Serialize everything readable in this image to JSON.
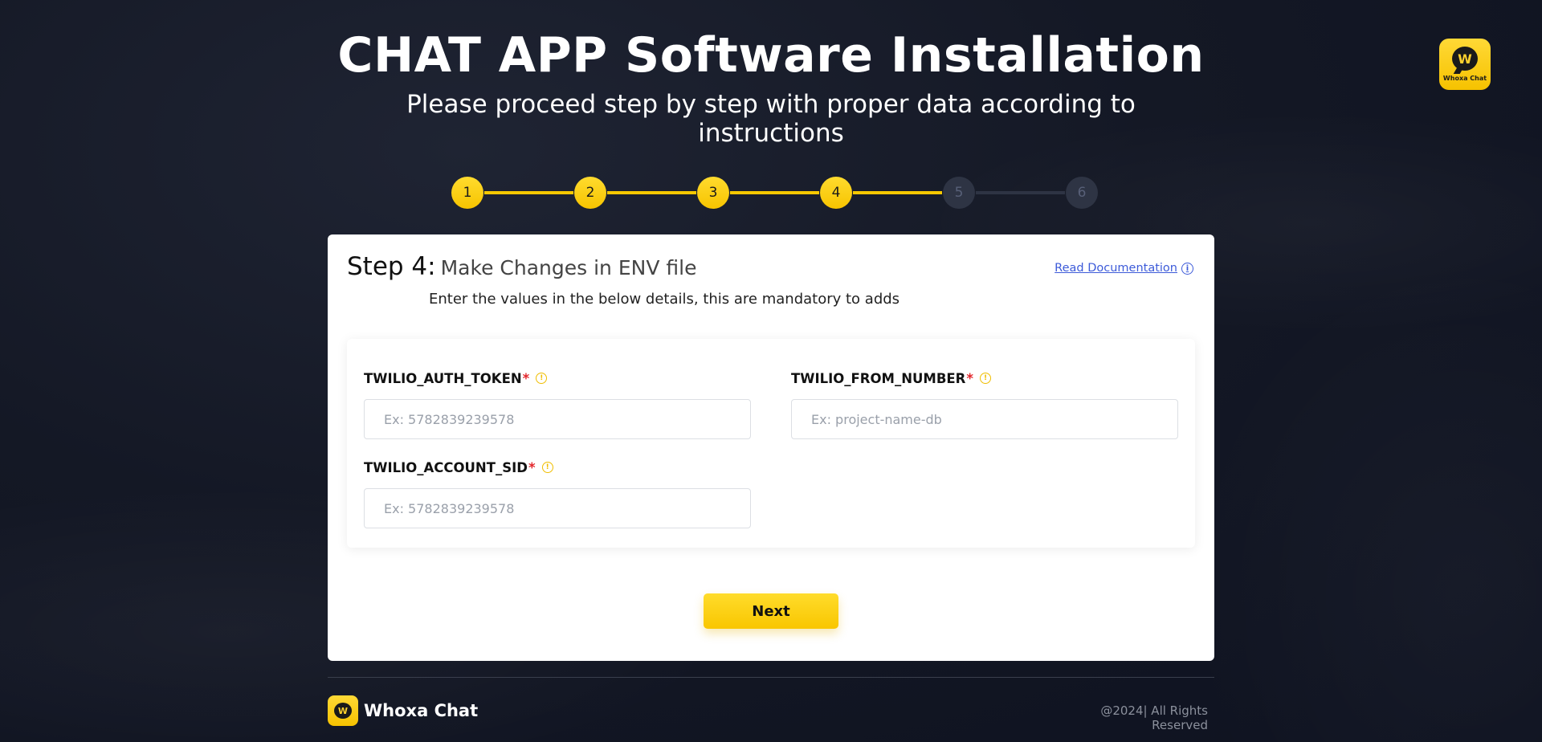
{
  "header": {
    "title": "CHAT APP Software Installation",
    "subtitle": "Please proceed step by step with proper data according to instructions"
  },
  "logo": {
    "letter": "W",
    "brand": "Whoxa Chat"
  },
  "stepper": {
    "steps": [
      {
        "label": "1",
        "state": "complete"
      },
      {
        "label": "2",
        "state": "complete"
      },
      {
        "label": "3",
        "state": "complete"
      },
      {
        "label": "4",
        "state": "current"
      },
      {
        "label": "5",
        "state": "pending"
      },
      {
        "label": "6",
        "state": "pending"
      }
    ]
  },
  "card": {
    "step_number": "Step 4:",
    "step_name": "Make Changes in ENV file",
    "instruction": "Enter the values in the below details, this are mandatory to adds",
    "doc_link": "Read Documentation",
    "next_label": "Next"
  },
  "fields": {
    "auth_token": {
      "label": "TWILIO_AUTH_TOKEN",
      "required": "*",
      "placeholder": "Ex: 5782839239578",
      "value": ""
    },
    "from_number": {
      "label": "TWILIO_FROM_NUMBER",
      "required": "*",
      "placeholder": "Ex: project-name-db",
      "value": ""
    },
    "account_sid": {
      "label": "TWILIO_ACCOUNT_SID",
      "required": "*",
      "placeholder": "Ex: 5782839239578",
      "value": ""
    }
  },
  "footer": {
    "brand": "Whoxa Chat",
    "copyright": "@2024| All Rights Reserved"
  },
  "colors": {
    "accent": "#f9c800",
    "background": "#141825",
    "required": "#e3262b",
    "link": "#3d5bd9"
  }
}
